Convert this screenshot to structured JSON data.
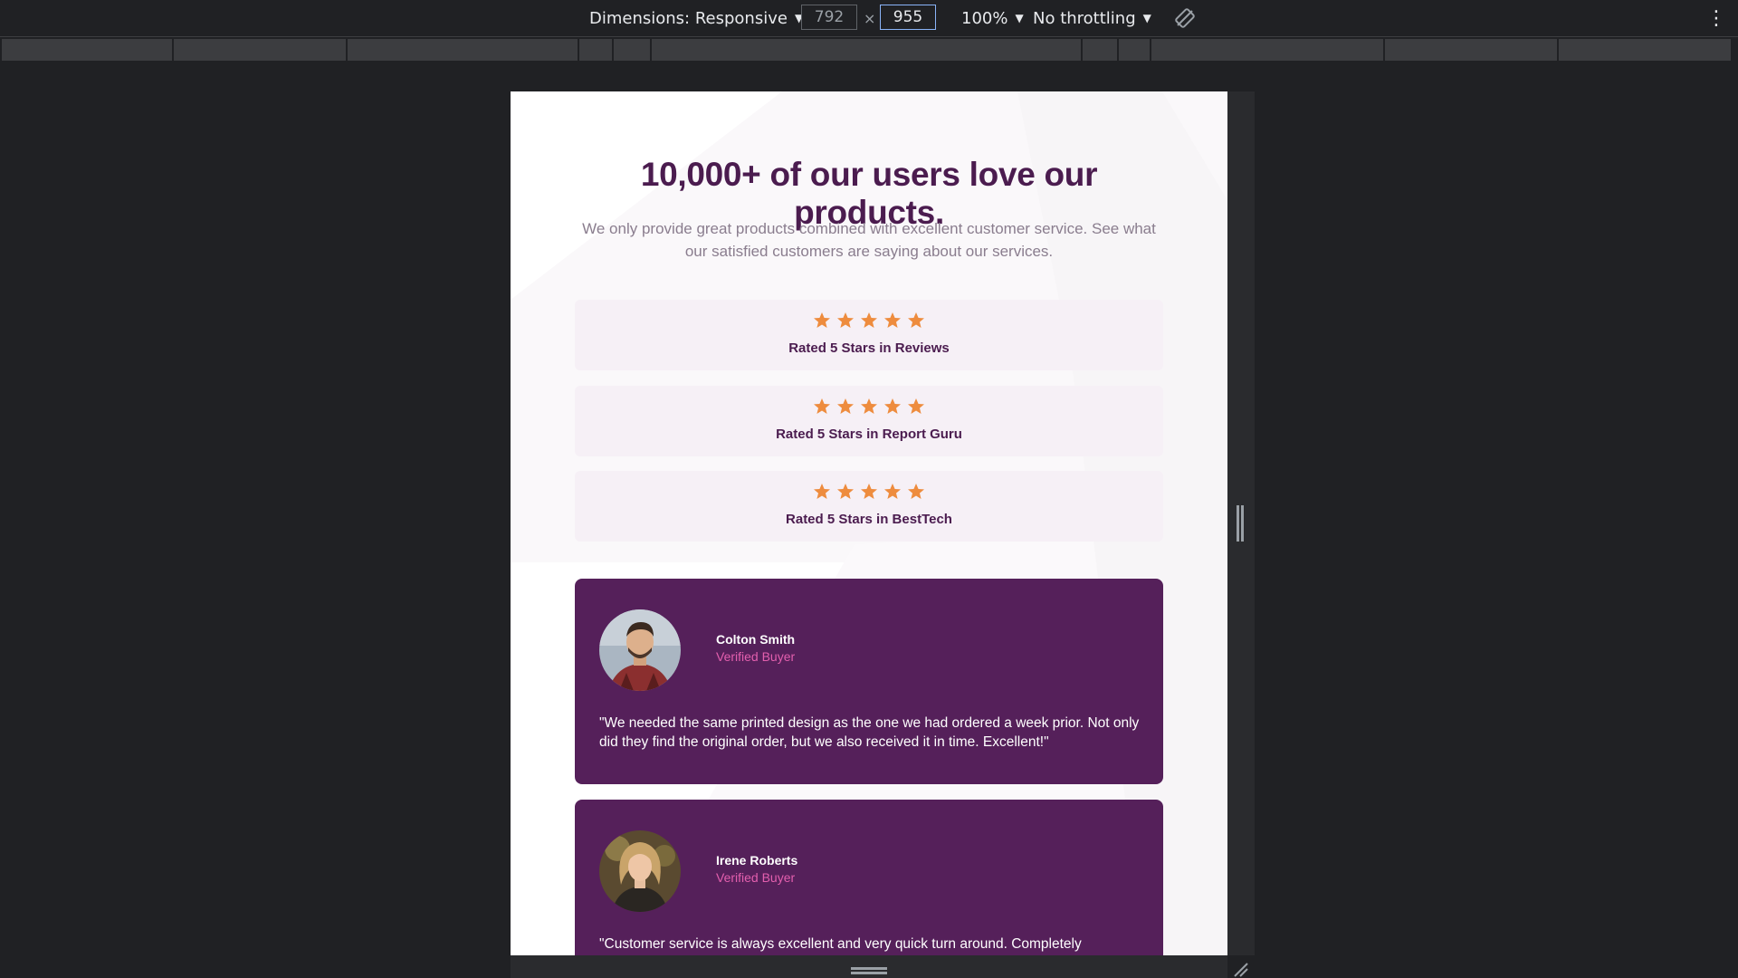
{
  "toolbar": {
    "dimensions_label": "Dimensions: Responsive",
    "width_value": "792",
    "height_value": "955",
    "times_sign": "×",
    "zoom": "100%",
    "throttling": "No throttling",
    "caret": "▼",
    "more": "⋮"
  },
  "page": {
    "headline": "10,000+ of our users love our products.",
    "subhead": "We only provide great products combined with excellent customer service. See what our satisfied customers are saying about our services.",
    "ratings": [
      {
        "label": "Rated 5 Stars in Reviews",
        "stars": 5
      },
      {
        "label": "Rated 5 Stars in Report Guru",
        "stars": 5
      },
      {
        "label": "Rated 5 Stars in BestTech",
        "stars": 5
      }
    ],
    "testimonials": [
      {
        "name": "Colton Smith",
        "role": "Verified Buyer",
        "quote": "\"We needed the same printed design as the one we had ordered a week prior. Not only did they find the original order, but we also received it in time. Excellent!\""
      },
      {
        "name": "Irene Roberts",
        "role": "Verified Buyer",
        "quote": "\"Customer service is always excellent and very quick turn around. Completely"
      }
    ]
  },
  "colors": {
    "headline": "#4b1c4f",
    "card_bg": "#55205a",
    "accent_pink": "#e35fae",
    "star": "#ee8c3e",
    "rating_bg": "#f6f0f6"
  }
}
